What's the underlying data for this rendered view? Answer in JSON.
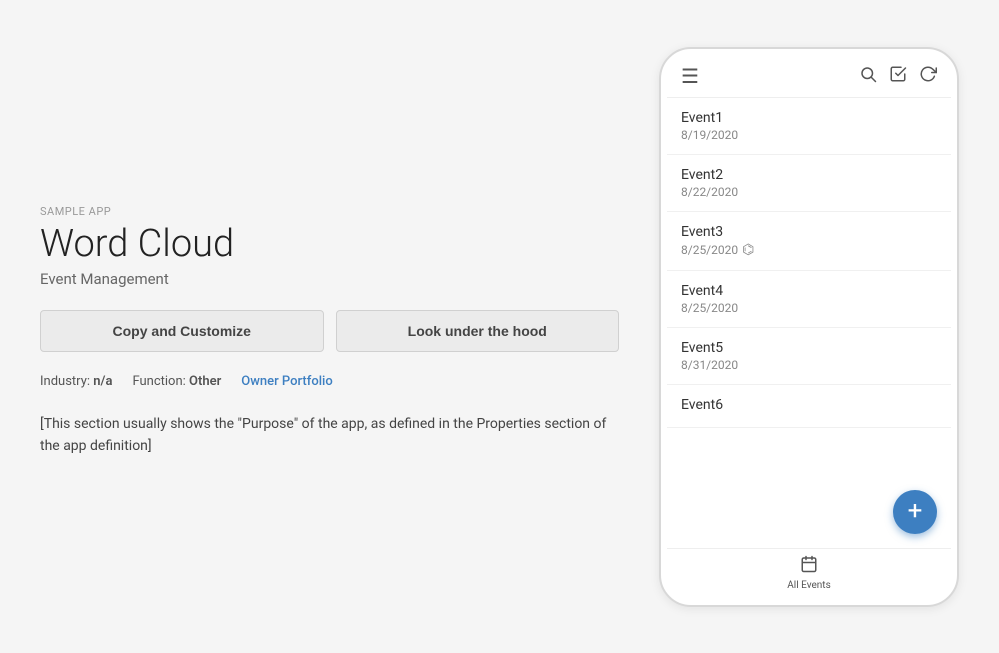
{
  "page": {
    "sample_label": "SAMPLE APP",
    "app_title": "Word Cloud",
    "app_subtitle": "Event Management",
    "buttons": {
      "copy": "Copy and Customize",
      "hood": "Look under the hood"
    },
    "meta": {
      "industry_label": "Industry:",
      "industry_value": "n/a",
      "function_label": "Function:",
      "function_value": "Other",
      "owner_link": "Owner Portfolio"
    },
    "description": "[This section usually shows the \"Purpose\" of the app, as defined in the Properties section of the app definition]"
  },
  "phone": {
    "toolbar": {
      "filter_icon": "≡",
      "search_icon": "🔍",
      "check_icon": "☑",
      "refresh_icon": "↻"
    },
    "events": [
      {
        "name": "Event1",
        "date": "8/19/2020"
      },
      {
        "name": "Event2",
        "date": "8/22/2020"
      },
      {
        "name": "Event3",
        "date": "8/25/2020"
      },
      {
        "name": "Event4",
        "date": "8/25/2020"
      },
      {
        "name": "Event5",
        "date": "8/31/2020"
      },
      {
        "name": "Event6",
        "date": ""
      }
    ],
    "fab_icon": "+",
    "bottom_nav": {
      "icon": "📅",
      "label": "All Events"
    }
  }
}
